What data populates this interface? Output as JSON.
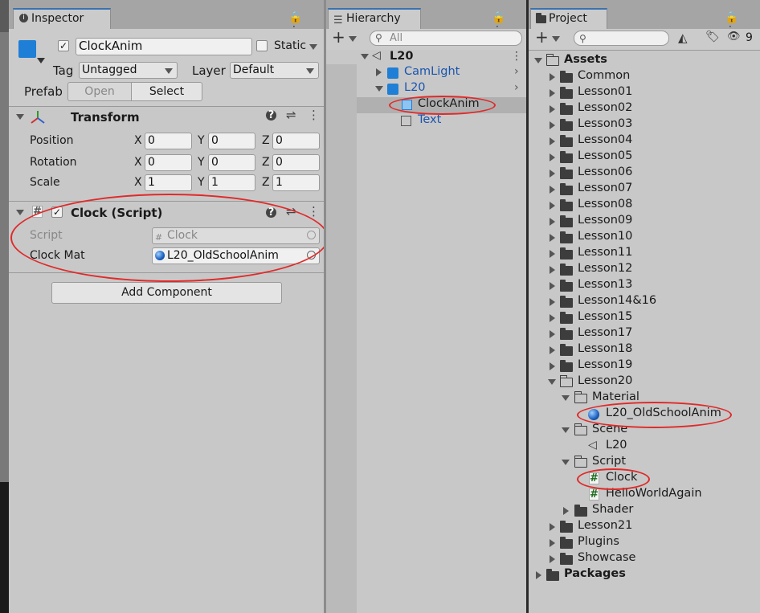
{
  "inspector": {
    "tab_label": "Inspector",
    "object_name": "ClockAnim",
    "static_label": "Static",
    "tag_label": "Tag",
    "tag_value": "Untagged",
    "layer_label": "Layer",
    "layer_value": "Default",
    "prefab_label": "Prefab",
    "prefab_open": "Open",
    "prefab_select": "Select",
    "transform": {
      "title": "Transform",
      "position_label": "Position",
      "rotation_label": "Rotation",
      "scale_label": "Scale",
      "axis_x": "X",
      "axis_y": "Y",
      "axis_z": "Z",
      "position": {
        "x": "0",
        "y": "0",
        "z": "0"
      },
      "rotation": {
        "x": "0",
        "y": "0",
        "z": "0"
      },
      "scale": {
        "x": "1",
        "y": "1",
        "z": "1"
      }
    },
    "clock_script": {
      "title": "Clock (Script)",
      "script_label": "Script",
      "script_value": "Clock",
      "mat_label": "Clock Mat",
      "mat_value": "L20_OldSchoolAnim"
    },
    "add_component": "Add Component"
  },
  "hierarchy": {
    "tab_label": "Hierarchy",
    "search_placeholder": "All",
    "scene_name": "L20",
    "items": [
      {
        "label": "CamLight"
      },
      {
        "label": "L20"
      },
      {
        "label": "ClockAnim"
      },
      {
        "label": "Text"
      }
    ]
  },
  "project": {
    "tab_label": "Project",
    "hidden_count": "9",
    "assets_label": "Assets",
    "folders": [
      "Common",
      "Lesson01",
      "Lesson02",
      "Lesson03",
      "Lesson04",
      "Lesson05",
      "Lesson06",
      "Lesson07",
      "Lesson08",
      "Lesson09",
      "Lesson10",
      "Lesson11",
      "Lesson12",
      "Lesson13",
      "Lesson14&16",
      "Lesson15",
      "Lesson17",
      "Lesson18",
      "Lesson19"
    ],
    "lesson20": "Lesson20",
    "material_folder": "Material",
    "material_item": "L20_OldSchoolAnim",
    "scene_folder": "Scene",
    "scene_item": "L20",
    "script_folder": "Script",
    "script_items": [
      "Clock",
      "HelloWorldAgain"
    ],
    "shader_folder": "Shader",
    "after_folders": [
      "Lesson21",
      "Plugins",
      "Showcase"
    ],
    "packages_label": "Packages"
  },
  "colors": {
    "accent": "#3a72b0",
    "annotation": "#e02a2a",
    "selection": "#b0b0b0",
    "link_blue": "#1a55b0"
  }
}
